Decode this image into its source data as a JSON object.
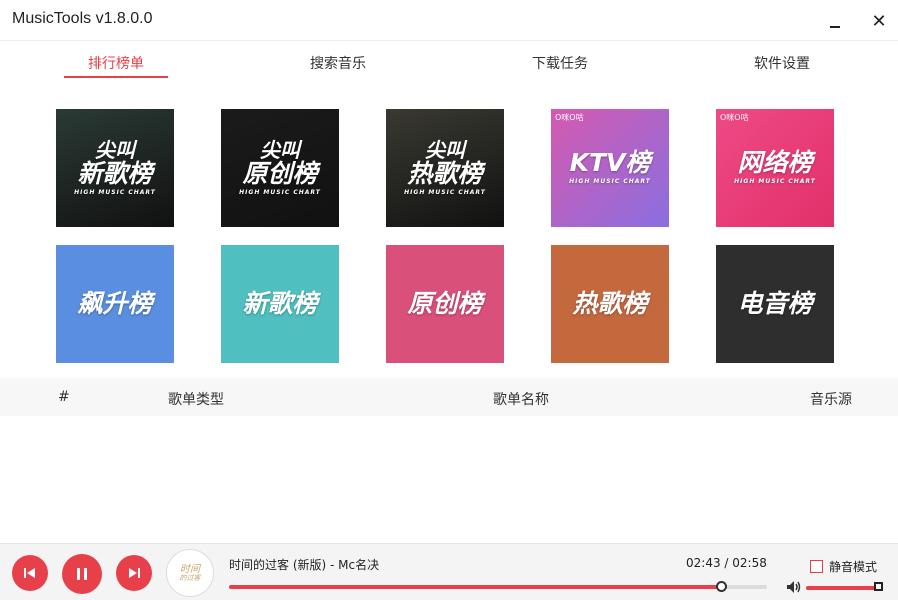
{
  "window": {
    "title": "MusicTools v1.8.0.0",
    "minimize_icon": "minimize-icon",
    "close_icon": "close-icon",
    "close_glyph": "✕"
  },
  "tabs": [
    {
      "label": "排行榜单",
      "active": true
    },
    {
      "label": "搜索音乐",
      "active": false
    },
    {
      "label": "下载任务",
      "active": false
    },
    {
      "label": "软件设置",
      "active": false
    }
  ],
  "charts_row1": [
    {
      "line1": "尖叫",
      "line2": "新歌榜",
      "sub": "HIGH MUSIC CHART",
      "bg": "#2b3a34"
    },
    {
      "line1": "尖叫",
      "line2": "原创榜",
      "sub": "HIGH MUSIC CHART",
      "bg": "#1b1b1b"
    },
    {
      "line1": "尖叫",
      "line2": "热歌榜",
      "sub": "HIGH MUSIC CHART",
      "bg": "#3a3a32"
    },
    {
      "brand": "O咪O咕",
      "line1": "",
      "line2": "KTV榜",
      "sub": "HIGH MUSIC CHART",
      "bg": "#c05ab8"
    },
    {
      "brand": "O咪O咕",
      "line1": "",
      "line2": "网络榜",
      "sub": "HIGH MUSIC CHART",
      "bg": "#e8407a"
    }
  ],
  "charts_row2": [
    {
      "line2": "飙升榜",
      "bg": "#5a8ee0"
    },
    {
      "line2": "新歌榜",
      "bg": "#4fbfbf"
    },
    {
      "line2": "原创榜",
      "bg": "#d9507a"
    },
    {
      "line2": "热歌榜",
      "bg": "#c4683e"
    },
    {
      "line2": "电音榜",
      "bg": "#2e2e2e"
    }
  ],
  "table": {
    "col_index": "#",
    "col_type": "歌单类型",
    "col_name": "歌单名称",
    "col_source": "音乐源"
  },
  "player": {
    "song_title": "时间的过客 (新版) - Mc名决",
    "time": "02:43 / 02:58",
    "progress": 0.915,
    "volume": 1.0,
    "mute_label": "静音模式",
    "mute_checked": false,
    "album_line1": "时间",
    "album_line2": "的过客",
    "accent": "#e8404a",
    "prev_icon": "skip-previous-icon",
    "pause_icon": "pause-icon",
    "next_icon": "skip-next-icon",
    "volume_icon": "volume-icon"
  }
}
